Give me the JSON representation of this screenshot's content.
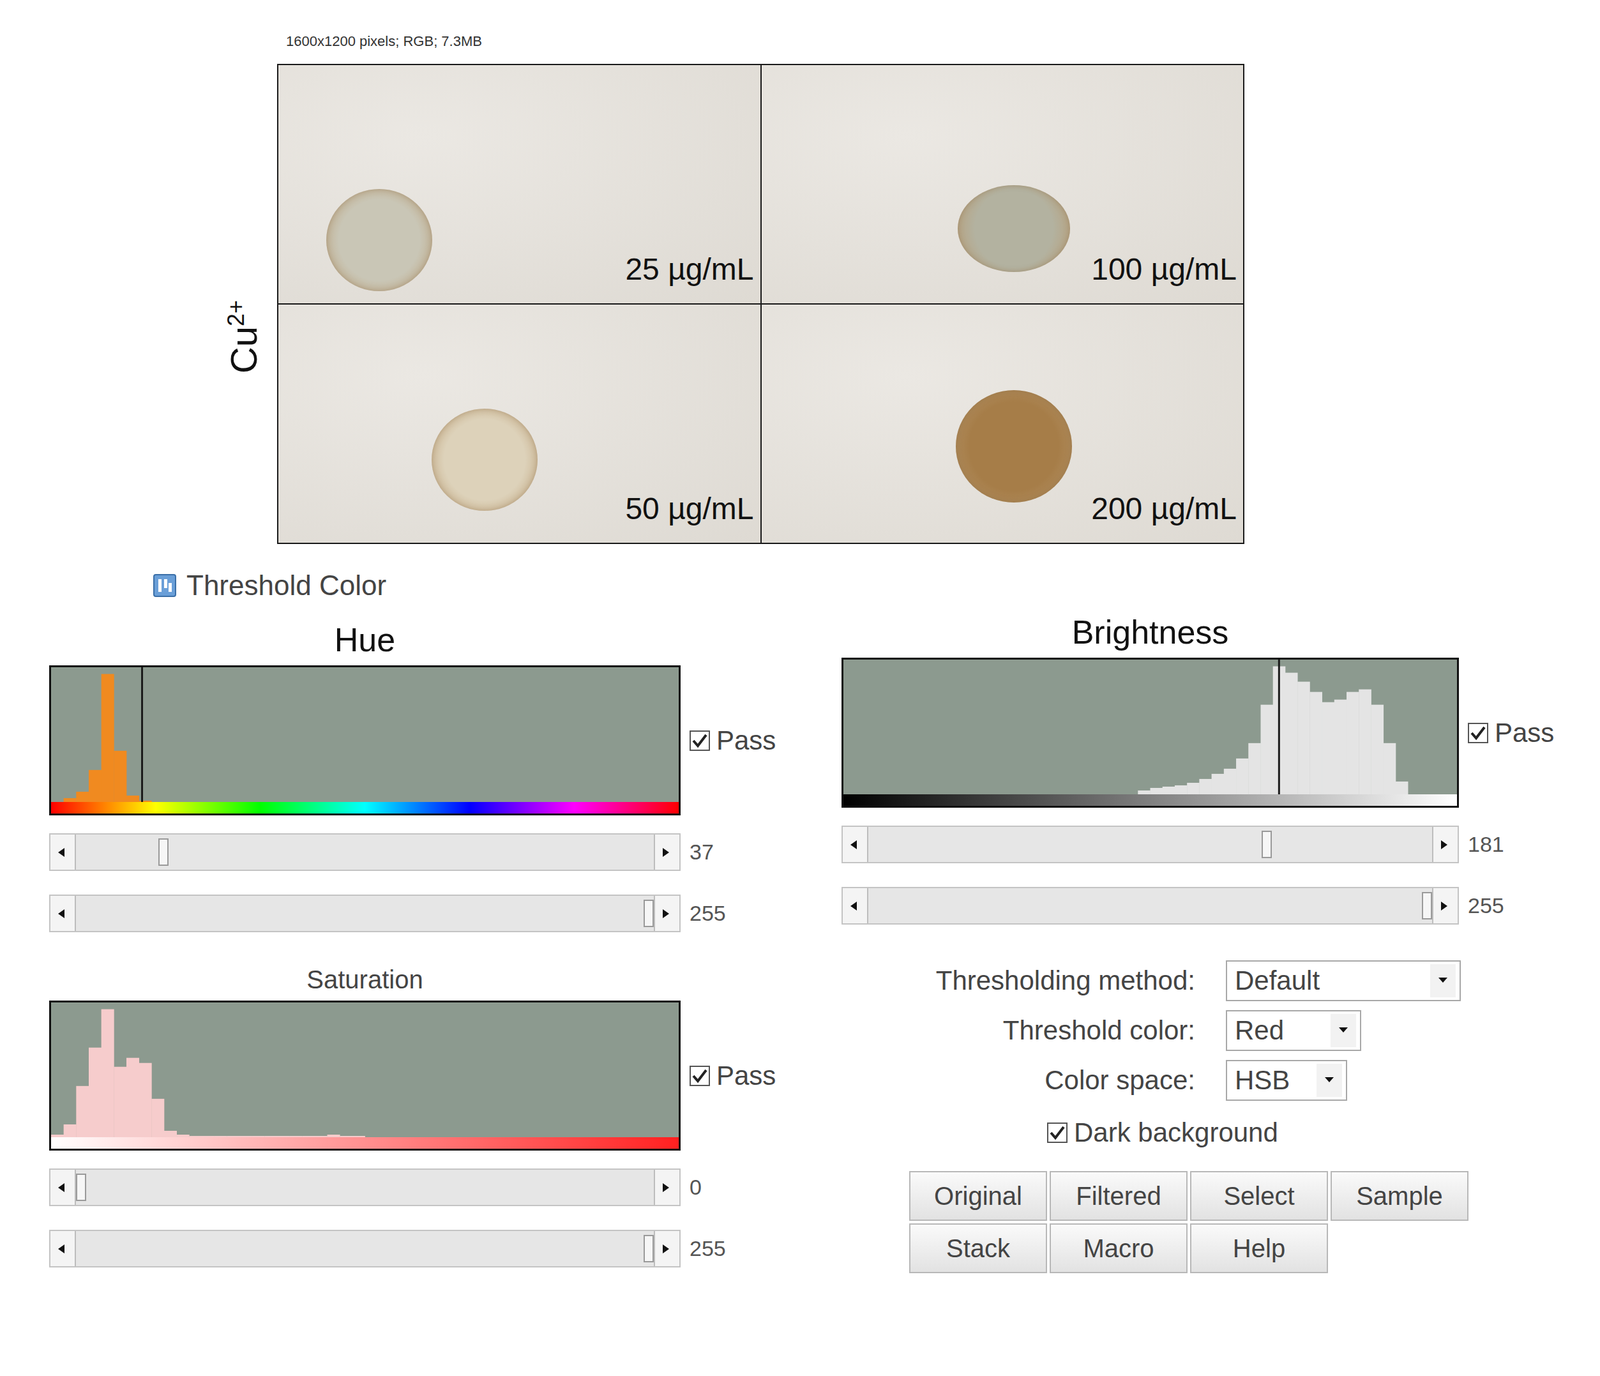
{
  "image_info": "1600x1200 pixels; RGB; 7.3MB",
  "photo": {
    "ion": "Cu",
    "ion_charge": "2+",
    "samples": [
      {
        "label": "25 µg/mL",
        "color": "#c9c6b6"
      },
      {
        "label": "100 µg/mL",
        "color": "#b3b2a0"
      },
      {
        "label": "50 µg/mL",
        "color": "#ddd2ba"
      },
      {
        "label": "200 µg/mL",
        "color": "#a67d48"
      }
    ]
  },
  "dialog": {
    "title": "Threshold Color",
    "channels": [
      {
        "name": "Hue",
        "kind": "hue",
        "pass": {
          "label": "Pass",
          "checked": true
        },
        "histogram": [
          0,
          3,
          8,
          25,
          100,
          40,
          5,
          1,
          0,
          0,
          0,
          0,
          0,
          0,
          0,
          0,
          0,
          0,
          0,
          0,
          0,
          0,
          0,
          0,
          0,
          0,
          0,
          0,
          0,
          0,
          0,
          0,
          0,
          0,
          0,
          0,
          0,
          0,
          0,
          0,
          0,
          0,
          0,
          0,
          0,
          0,
          0,
          0,
          0,
          0
        ],
        "min": {
          "value": "37",
          "level": 0.145
        },
        "max": {
          "value": "255",
          "level": 1
        }
      },
      {
        "name": "Saturation",
        "kind": "saturation",
        "pass": {
          "label": "Pass",
          "checked": true
        },
        "histogram": [
          2,
          10,
          40,
          70,
          100,
          55,
          62,
          58,
          30,
          5,
          2,
          1,
          1,
          1,
          1,
          1,
          1,
          1,
          1,
          1,
          1,
          1,
          2,
          1,
          1,
          0,
          0,
          0,
          0,
          0,
          0,
          0,
          0,
          0,
          0,
          0,
          0,
          0,
          0,
          0,
          0,
          0,
          0,
          0,
          0,
          0,
          0,
          0,
          0,
          0
        ],
        "min": {
          "value": "0",
          "level": 0
        },
        "max": {
          "value": "255",
          "level": 1
        }
      },
      {
        "name": "Brightness",
        "kind": "brightness",
        "pass": {
          "label": "Pass",
          "checked": true
        },
        "histogram": [
          0,
          0,
          0,
          0,
          0,
          0,
          0,
          0,
          0,
          0,
          0,
          0,
          0,
          0,
          0,
          0,
          0,
          0,
          0,
          0,
          0,
          0,
          0,
          0,
          3,
          5,
          6,
          7,
          9,
          12,
          16,
          20,
          28,
          40,
          70,
          100,
          95,
          88,
          80,
          72,
          74,
          80,
          82,
          70,
          40,
          10,
          0,
          0,
          0,
          0
        ],
        "min": {
          "value": "181",
          "level": 0.71
        },
        "max": {
          "value": "255",
          "level": 1
        }
      }
    ],
    "options": [
      {
        "label": "Thresholding method:",
        "value": "Default"
      },
      {
        "label": "Threshold color:",
        "value": "Red"
      },
      {
        "label": "Color space:",
        "value": "HSB"
      }
    ],
    "dark_background": {
      "label": "Dark background",
      "checked": true
    },
    "buttons": [
      "Original",
      "Filtered",
      "Select",
      "Sample",
      "Stack",
      "Macro",
      "Help"
    ]
  }
}
